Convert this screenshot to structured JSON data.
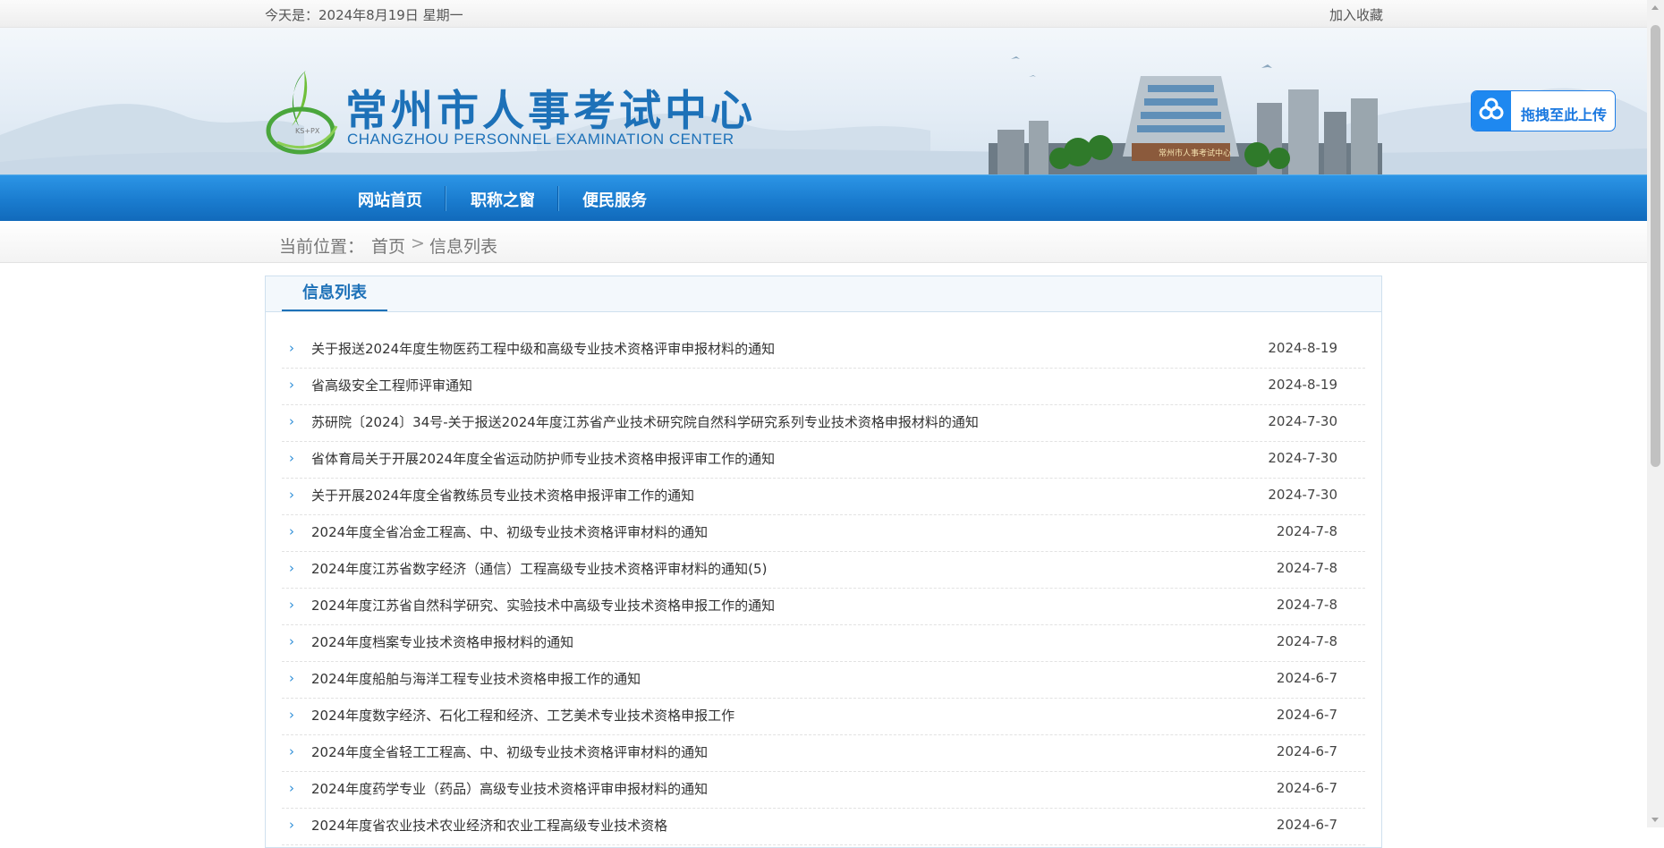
{
  "topbar": {
    "date_text": "今天是：2024年8月19日 星期一",
    "favorite_label": "加入收藏"
  },
  "header": {
    "site_name_cn": "常州市人事考试中心",
    "site_name_en": "CHANGZHOU PERSONNEL EXAMINATION CENTER",
    "logo_badge": "KS+PX",
    "building_sign": "常州市人事考试中心"
  },
  "upload": {
    "label": "拖拽至此上传",
    "icon": "cloud-upload-icon",
    "color": "#1e88f0"
  },
  "nav": {
    "items": [
      {
        "label": "网站首页"
      },
      {
        "label": "职称之窗"
      },
      {
        "label": "便民服务"
      }
    ]
  },
  "breadcrumb": {
    "prefix": "当前位置：",
    "home": "首页",
    "separator": ">",
    "current": "信息列表"
  },
  "panel": {
    "title": "信息列表"
  },
  "list": [
    {
      "title": "关于报送2024年度生物医药工程中级和高级专业技术资格评审申报材料的通知",
      "date": "2024-8-19"
    },
    {
      "title": "省高级安全工程师评审通知",
      "date": "2024-8-19"
    },
    {
      "title": "苏研院〔2024〕34号-关于报送2024年度江苏省产业技术研究院自然科学研究系列专业技术资格申报材料的通知",
      "date": "2024-7-30"
    },
    {
      "title": "省体育局关于开展2024年度全省运动防护师专业技术资格申报评审工作的通知",
      "date": "2024-7-30"
    },
    {
      "title": "关于开展2024年度全省教练员专业技术资格申报评审工作的通知",
      "date": "2024-7-30"
    },
    {
      "title": "2024年度全省冶金工程高、中、初级专业技术资格评审材料的通知",
      "date": "2024-7-8"
    },
    {
      "title": "2024年度江苏省数字经济（通信）工程高级专业技术资格评审材料的通知(5)",
      "date": "2024-7-8"
    },
    {
      "title": "2024年度江苏省自然科学研究、实验技术中高级专业技术资格申报工作的通知",
      "date": "2024-7-8"
    },
    {
      "title": "2024年度档案专业技术资格申报材料的通知",
      "date": "2024-7-8"
    },
    {
      "title": "2024年度船舶与海洋工程专业技术资格申报工作的通知",
      "date": "2024-6-7"
    },
    {
      "title": "2024年度数字经济、石化工程和经济、工艺美术专业技术资格申报工作",
      "date": "2024-6-7"
    },
    {
      "title": "2024年度全省轻工工程高、中、初级专业技术资格评审材料的通知",
      "date": "2024-6-7"
    },
    {
      "title": "2024年度药学专业（药品）高级专业技术资格评审申报材料的通知",
      "date": "2024-6-7"
    },
    {
      "title": "2024年度省农业技术农业经济和农业工程高级专业技术资格",
      "date": "2024-6-7"
    }
  ],
  "colors": {
    "brand_blue": "#1d71b8",
    "nav_blue": "#1a7ccf",
    "list_chevron": "#2f8fd8"
  }
}
